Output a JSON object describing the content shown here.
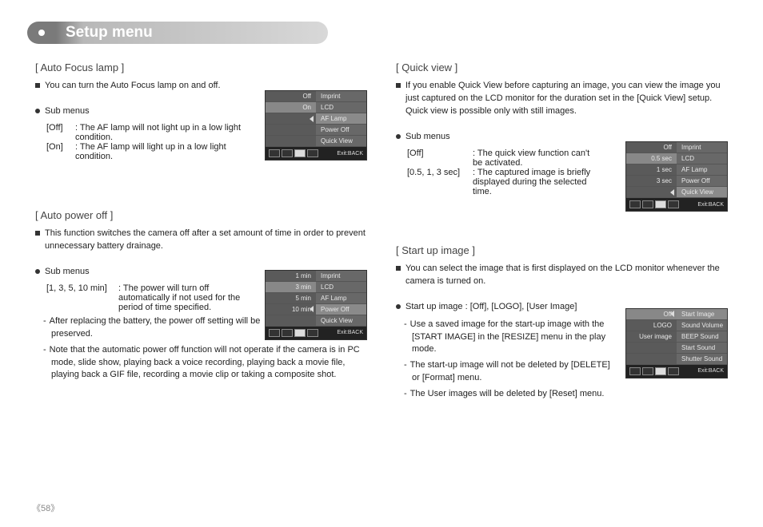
{
  "title": "Setup menu",
  "page_number": "58",
  "sections": {
    "af_lamp": {
      "heading": "[ Auto Focus lamp ]",
      "desc": "You can turn the Auto Focus lamp on and off.",
      "sub_label": "Sub menus",
      "off_key": "[Off]",
      "off_val": ": The AF lamp will not light up in a low light condition.",
      "on_key": "[On]",
      "on_val": ": The AF lamp will light up in a low light condition.",
      "lcd": {
        "left": [
          "Off",
          "On",
          "",
          "",
          ""
        ],
        "right": [
          "Imprint",
          "LCD",
          "AF Lamp",
          "Power Off",
          "Quick View"
        ],
        "highlight_left": 1,
        "highlight_right": 2,
        "exit": "Exit:BACK"
      }
    },
    "auto_power_off": {
      "heading": "[ Auto power off ]",
      "desc": "This function switches the camera off after a set amount of time in order to prevent unnecessary battery drainage.",
      "sub_label": "Sub menus",
      "k": "[1, 3, 5, 10 min]",
      "v": ": The power will turn off automatically if not used for the period of time specified.",
      "notes": [
        "After replacing the battery, the power off setting will be preserved.",
        "Note that the automatic power off function will not operate if the camera is in PC mode, slide show, playing back a voice recording, playing back a movie file, playing back a GIF file, recording a movie clip or taking a composite shot."
      ],
      "lcd": {
        "left": [
          "1 min",
          "3 min",
          "5 min",
          "10 min",
          ""
        ],
        "right": [
          "Imprint",
          "LCD",
          "AF Lamp",
          "Power Off",
          "Quick View"
        ],
        "highlight_left": 1,
        "highlight_right": 3,
        "exit": "Exit:BACK"
      }
    },
    "quick_view": {
      "heading": "[ Quick view ]",
      "desc": "If you enable Quick View before capturing an image, you can view the image you just captured on the LCD monitor for the duration set in the [Quick View] setup. Quick view is possible only with still images.",
      "sub_label": "Sub menus",
      "off_key": "[Off]",
      "off_val": ": The quick view function can't be activated.",
      "sec_key": "[0.5, 1, 3 sec]",
      "sec_val": ": The captured image is briefly displayed during the selected time.",
      "lcd": {
        "left": [
          "Off",
          "0.5 sec",
          "1 sec",
          "3 sec",
          ""
        ],
        "right": [
          "Imprint",
          "LCD",
          "AF Lamp",
          "Power Off",
          "Quick View"
        ],
        "highlight_left": 1,
        "highlight_right": 4,
        "exit": "Exit:BACK"
      }
    },
    "startup": {
      "heading": "[ Start up image ]",
      "desc": "You can select the image that is first displayed on the LCD monitor whenever the camera is turned on.",
      "sub_label": "Start up image : [Off], [LOGO], [User Image]",
      "notes": [
        "Use a saved image for the start-up image with the [START IMAGE] in the [RESIZE] menu in the play mode.",
        "The start-up image will not be deleted by [DELETE] or [Format] menu.",
        "The User images will be deleted by [Reset] menu."
      ],
      "lcd": {
        "left": [
          "Off",
          "LOGO",
          "User image",
          "",
          ""
        ],
        "right": [
          "Start Image",
          "Sound Volume",
          "BEEP Sound",
          "Start Sound",
          "Shutter Sound"
        ],
        "highlight_left": 0,
        "highlight_right": 0,
        "exit": "Exit:BACK"
      }
    }
  }
}
